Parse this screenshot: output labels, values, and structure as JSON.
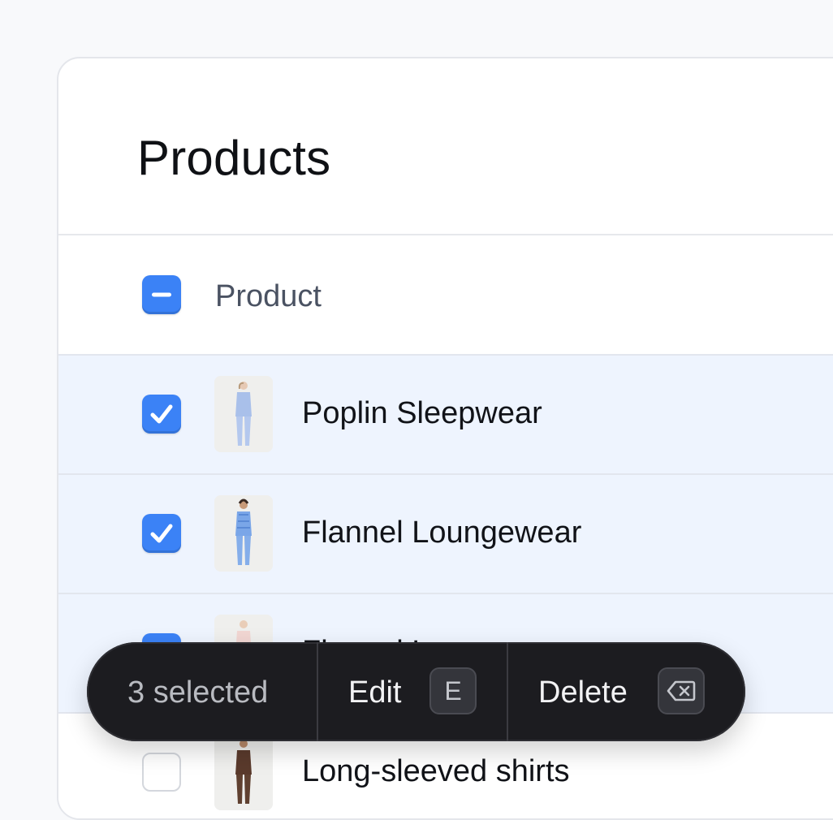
{
  "page": {
    "title": "Products"
  },
  "table": {
    "header": {
      "label": "Product",
      "checkbox_state": "indeterminate"
    },
    "rows": [
      {
        "label": "Poplin Sleepwear",
        "selected": true
      },
      {
        "label": "Flannel Loungewear",
        "selected": true
      },
      {
        "label": "Flannel Loungewear",
        "selected": true
      },
      {
        "label": "Long-sleeved shirts",
        "selected": false
      }
    ]
  },
  "toolbar": {
    "count_label": "3 selected",
    "edit_label": "Edit",
    "edit_shortcut": "E",
    "delete_label": "Delete",
    "delete_shortcut_icon": "backspace-icon"
  },
  "colors": {
    "accent": "#3b82f6",
    "selected_row_bg": "#eef4fe",
    "toolbar_bg": "#1c1c20"
  }
}
